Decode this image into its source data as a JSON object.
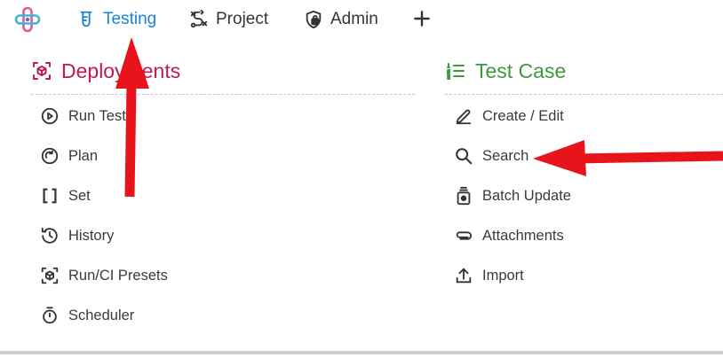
{
  "topnav": {
    "tabs": [
      {
        "label": "Testing",
        "icon": "flask-icon",
        "active": true
      },
      {
        "label": "Project",
        "icon": "route-icon"
      },
      {
        "label": "Admin",
        "icon": "shield-lock-icon"
      }
    ],
    "add_icon": "plus-icon"
  },
  "deployments": {
    "title": "Deployments",
    "color": "#c2185b",
    "items": [
      {
        "label": "Run Tests",
        "icon": "play-circle-icon"
      },
      {
        "label": "Plan",
        "icon": "refresh-circle-icon"
      },
      {
        "label": "Set",
        "icon": "brackets-icon"
      },
      {
        "label": "History",
        "icon": "history-icon"
      },
      {
        "label": "Run/CI Presets",
        "icon": "cube-frame-icon"
      },
      {
        "label": "Scheduler",
        "icon": "stopwatch-icon"
      }
    ]
  },
  "test_case": {
    "title": "Test Case",
    "color": "#3c9a3c",
    "items": [
      {
        "label": "Create / Edit",
        "icon": "pencil-icon"
      },
      {
        "label": "Search",
        "icon": "search-icon"
      },
      {
        "label": "Batch Update",
        "icon": "batch-icon"
      },
      {
        "label": "Attachments",
        "icon": "paperclip-icon"
      },
      {
        "label": "Import",
        "icon": "upload-icon"
      }
    ]
  },
  "colors": {
    "accent": "#1a7fd6",
    "annotation_arrow": "#e8141b"
  }
}
